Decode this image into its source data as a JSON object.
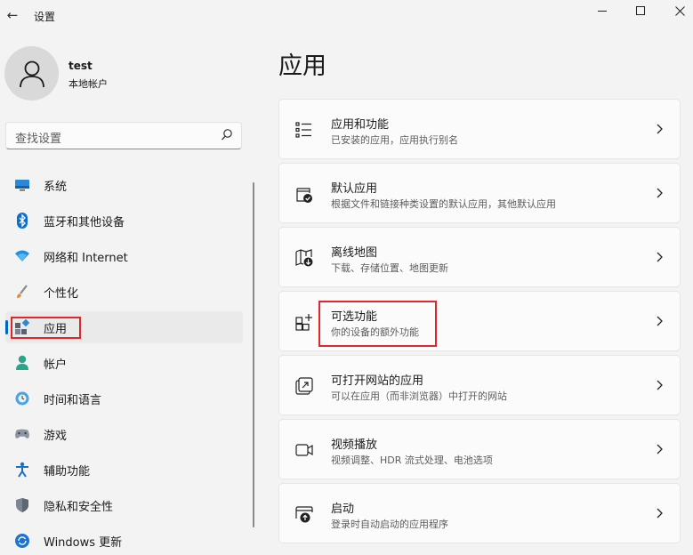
{
  "window": {
    "title": "设置"
  },
  "user": {
    "name": "test",
    "account_type": "本地帐户"
  },
  "search": {
    "placeholder": "查找设置"
  },
  "nav": {
    "items": [
      {
        "label": "系统",
        "icon": "system-icon"
      },
      {
        "label": "蓝牙和其他设备",
        "icon": "bluetooth-icon"
      },
      {
        "label": "网络和 Internet",
        "icon": "wifi-icon"
      },
      {
        "label": "个性化",
        "icon": "brush-icon"
      },
      {
        "label": "应用",
        "icon": "apps-icon",
        "selected": true
      },
      {
        "label": "帐户",
        "icon": "person-icon"
      },
      {
        "label": "时间和语言",
        "icon": "globe-clock-icon"
      },
      {
        "label": "游戏",
        "icon": "gamepad-icon"
      },
      {
        "label": "辅助功能",
        "icon": "accessibility-icon"
      },
      {
        "label": "隐私和安全性",
        "icon": "shield-icon"
      },
      {
        "label": "Windows 更新",
        "icon": "update-icon"
      }
    ]
  },
  "main": {
    "title": "应用",
    "cards": [
      {
        "title": "应用和功能",
        "subtitle": "已安装的应用，应用执行别名",
        "icon": "list-icon"
      },
      {
        "title": "默认应用",
        "subtitle": "根据文件和链接种类设置的默认应用，其他默认应用",
        "icon": "default-apps-icon"
      },
      {
        "title": "离线地图",
        "subtitle": "下载、存储位置、地图更新",
        "icon": "map-download-icon"
      },
      {
        "title": "可选功能",
        "subtitle": "你的设备的额外功能",
        "icon": "add-grid-icon",
        "highlighted": true
      },
      {
        "title": "可打开网站的应用",
        "subtitle": "可以在应用（而非浏览器）中打开的网站",
        "icon": "open-external-icon"
      },
      {
        "title": "视频播放",
        "subtitle": "视频调整、HDR 流式处理、电池选项",
        "icon": "video-icon"
      },
      {
        "title": "启动",
        "subtitle": "登录时自动启动的应用程序",
        "icon": "startup-icon"
      }
    ]
  },
  "colors": {
    "accent": "#0067c0",
    "highlight": "#e0252b",
    "background": "#f3f3f3",
    "card": "#fbfbfb"
  }
}
